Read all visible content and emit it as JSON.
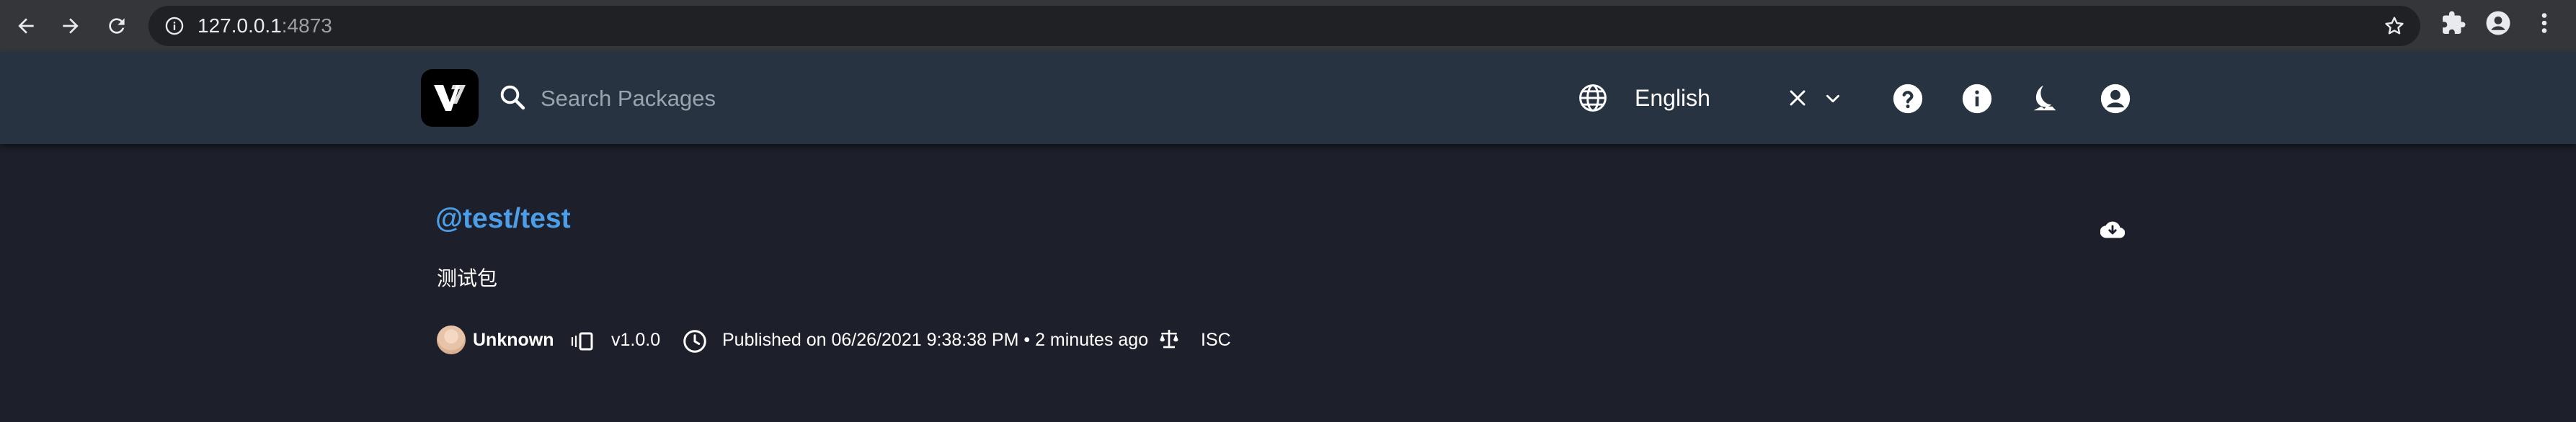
{
  "browser": {
    "url_host": "127.0.0.1",
    "url_port": ":4873"
  },
  "header": {
    "search_placeholder": "Search Packages",
    "language": "English"
  },
  "package": {
    "name": "@test/test",
    "description": "测试包",
    "author": "Unknown",
    "version": "v1.0.0",
    "published": "Published on 06/26/2021 9:38:38 PM • 2 minutes ago",
    "license": "ISC"
  },
  "colors": {
    "header_bg": "#273340",
    "page_bg": "#1d202a",
    "link": "#4b9ee7"
  }
}
